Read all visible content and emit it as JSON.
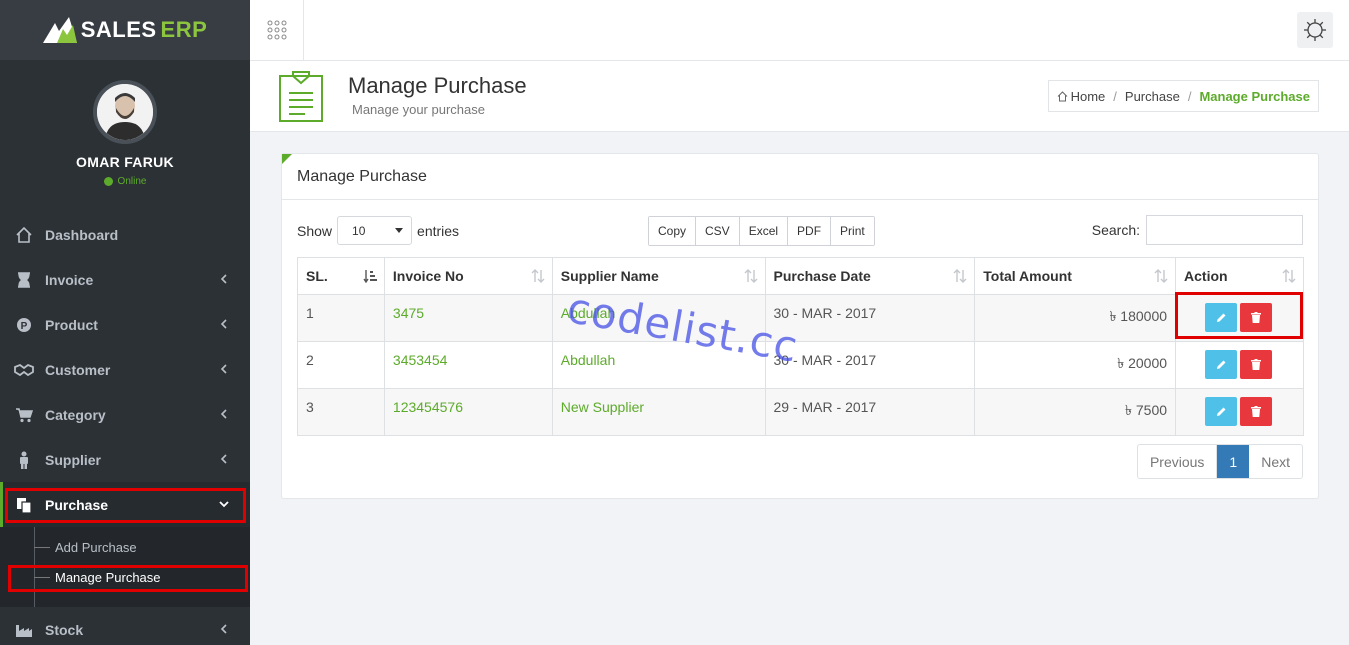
{
  "brand": {
    "word1": "SALES",
    "word2": "ERP"
  },
  "user": {
    "name": "OMAR FARUK",
    "status": "Online"
  },
  "sidebar": {
    "items": [
      {
        "label": "Dashboard"
      },
      {
        "label": "Invoice"
      },
      {
        "label": "Product"
      },
      {
        "label": "Customer"
      },
      {
        "label": "Category"
      },
      {
        "label": "Supplier"
      },
      {
        "label": "Purchase"
      },
      {
        "label": "Stock"
      }
    ],
    "purchase_sub": [
      {
        "label": "Add Purchase"
      },
      {
        "label": "Manage Purchase"
      }
    ]
  },
  "header": {
    "title": "Manage Purchase",
    "subtitle": "Manage your purchase",
    "breadcrumb": [
      "Home",
      "Purchase",
      "Manage Purchase"
    ]
  },
  "panel": {
    "title": "Manage Purchase",
    "show_label": "Show",
    "page_size": "10",
    "entries_label": "entries",
    "export_buttons": [
      "Copy",
      "CSV",
      "Excel",
      "PDF",
      "Print"
    ],
    "search_label": "Search:"
  },
  "table": {
    "columns": [
      "SL.",
      "Invoice No",
      "Supplier Name",
      "Purchase Date",
      "Total Amount",
      "Action"
    ],
    "rows": [
      {
        "sl": "1",
        "invoice": "3475",
        "supplier": "Abdullah",
        "date": "30 - MAR - 2017",
        "amount": "৳ 180000"
      },
      {
        "sl": "2",
        "invoice": "3453454",
        "supplier": "Abdullah",
        "date": "30 - MAR - 2017",
        "amount": "৳ 20000"
      },
      {
        "sl": "3",
        "invoice": "123454576",
        "supplier": "New Supplier",
        "date": "29 - MAR - 2017",
        "amount": "৳ 7500"
      }
    ]
  },
  "pagination": {
    "previous": "Previous",
    "current": "1",
    "next": "Next"
  },
  "watermark": "codelist.cc",
  "colors": {
    "accent": "#5dab2b",
    "sidebar_bg": "#2c3136",
    "edit": "#4fc1e9",
    "delete": "#e8383d",
    "highlight": "#e00000"
  }
}
